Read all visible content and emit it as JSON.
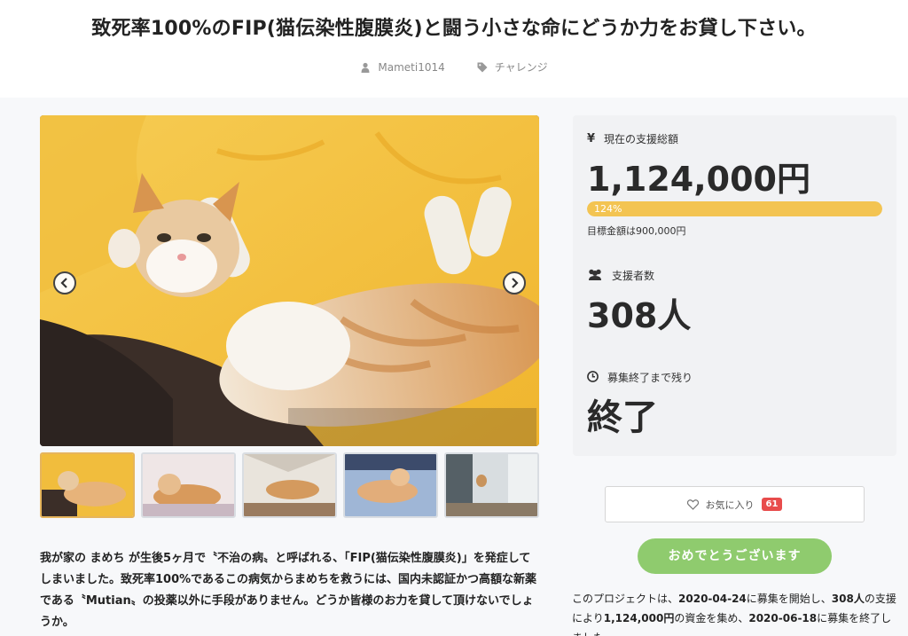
{
  "title": "致死率100%のFIP(猫伝染性腹膜炎)と闘う小さな命にどうか力をお貸し下さい。",
  "meta": {
    "author": "Mameti1014",
    "category": "チャレンジ",
    "author_icon": "user-icon",
    "category_icon": "tag-icon"
  },
  "description": "我が家の まめち が生後5ヶ月で〝不治の病〟と呼ばれる、「FIP(猫伝染性腹膜炎)」を発症してしまいました。致死率100%であるこの病気からまめちを救うには、国内未認証かつ高額な新薬である〝Mutian〟の投薬以外に手段がありません。どうか皆様のお力を貸して頂けないでしょうか。",
  "funding": {
    "label": "現在の支援総額",
    "amount": "1,124,000円",
    "percent_label": "124%",
    "progress": 1.0,
    "goal": "目標金額は900,000円"
  },
  "supporters": {
    "label": "支援者数",
    "value": "308人"
  },
  "remaining": {
    "label": "募集終了まで残り",
    "value": "終了"
  },
  "favorite": {
    "label": "お気に入り",
    "count": "61"
  },
  "cta_label": "おめでとうございます",
  "summary": {
    "p1": "このプロジェクトは、",
    "start": "2020-04-24",
    "p2": "に募集を開始し、",
    "backers": "308人",
    "p3": "の支援により",
    "total": "1,124,000円",
    "p4": "の資金を集め、",
    "end": "2020-06-18",
    "p5": "に募集を終了しました"
  },
  "colors": {
    "accent_progress": "#f3c452",
    "cta_green": "#8fcb6e",
    "badge_red": "#e84c4c"
  }
}
